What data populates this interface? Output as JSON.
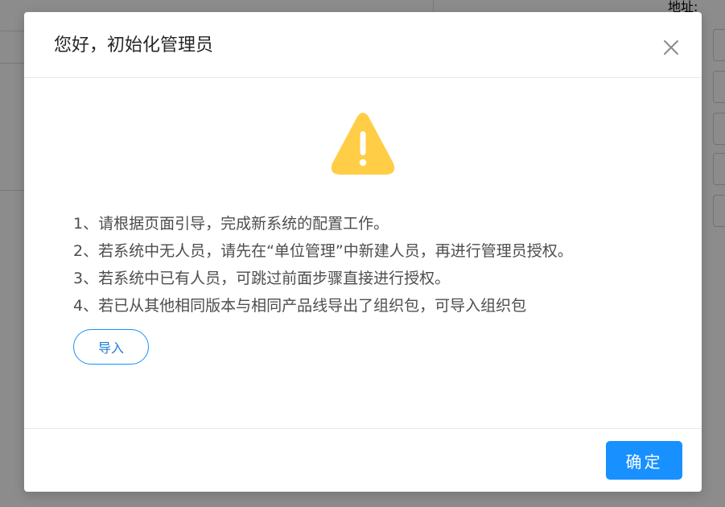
{
  "background": {
    "address_label": "地址:"
  },
  "dialog": {
    "title": "您好，初始化管理员",
    "warning_icon": "warning-triangle-icon",
    "close_icon": "close-icon",
    "instructions": [
      "1、请根据页面引导，完成新系统的配置工作。",
      "2、若系统中无人员，请先在“单位管理”中新建人员，再进行管理员授权。",
      "3、若系统中已有人员，可跳过前面步骤直接进行授权。",
      "4、若已从其他相同版本与相同产品线导出了组织包，可导入组织包"
    ],
    "import_label": "导入",
    "confirm_label": "确定"
  },
  "colors": {
    "primary": "#1890ff",
    "warning": "#ffcd46",
    "mask": "rgba(0,0,0,0.45)"
  }
}
